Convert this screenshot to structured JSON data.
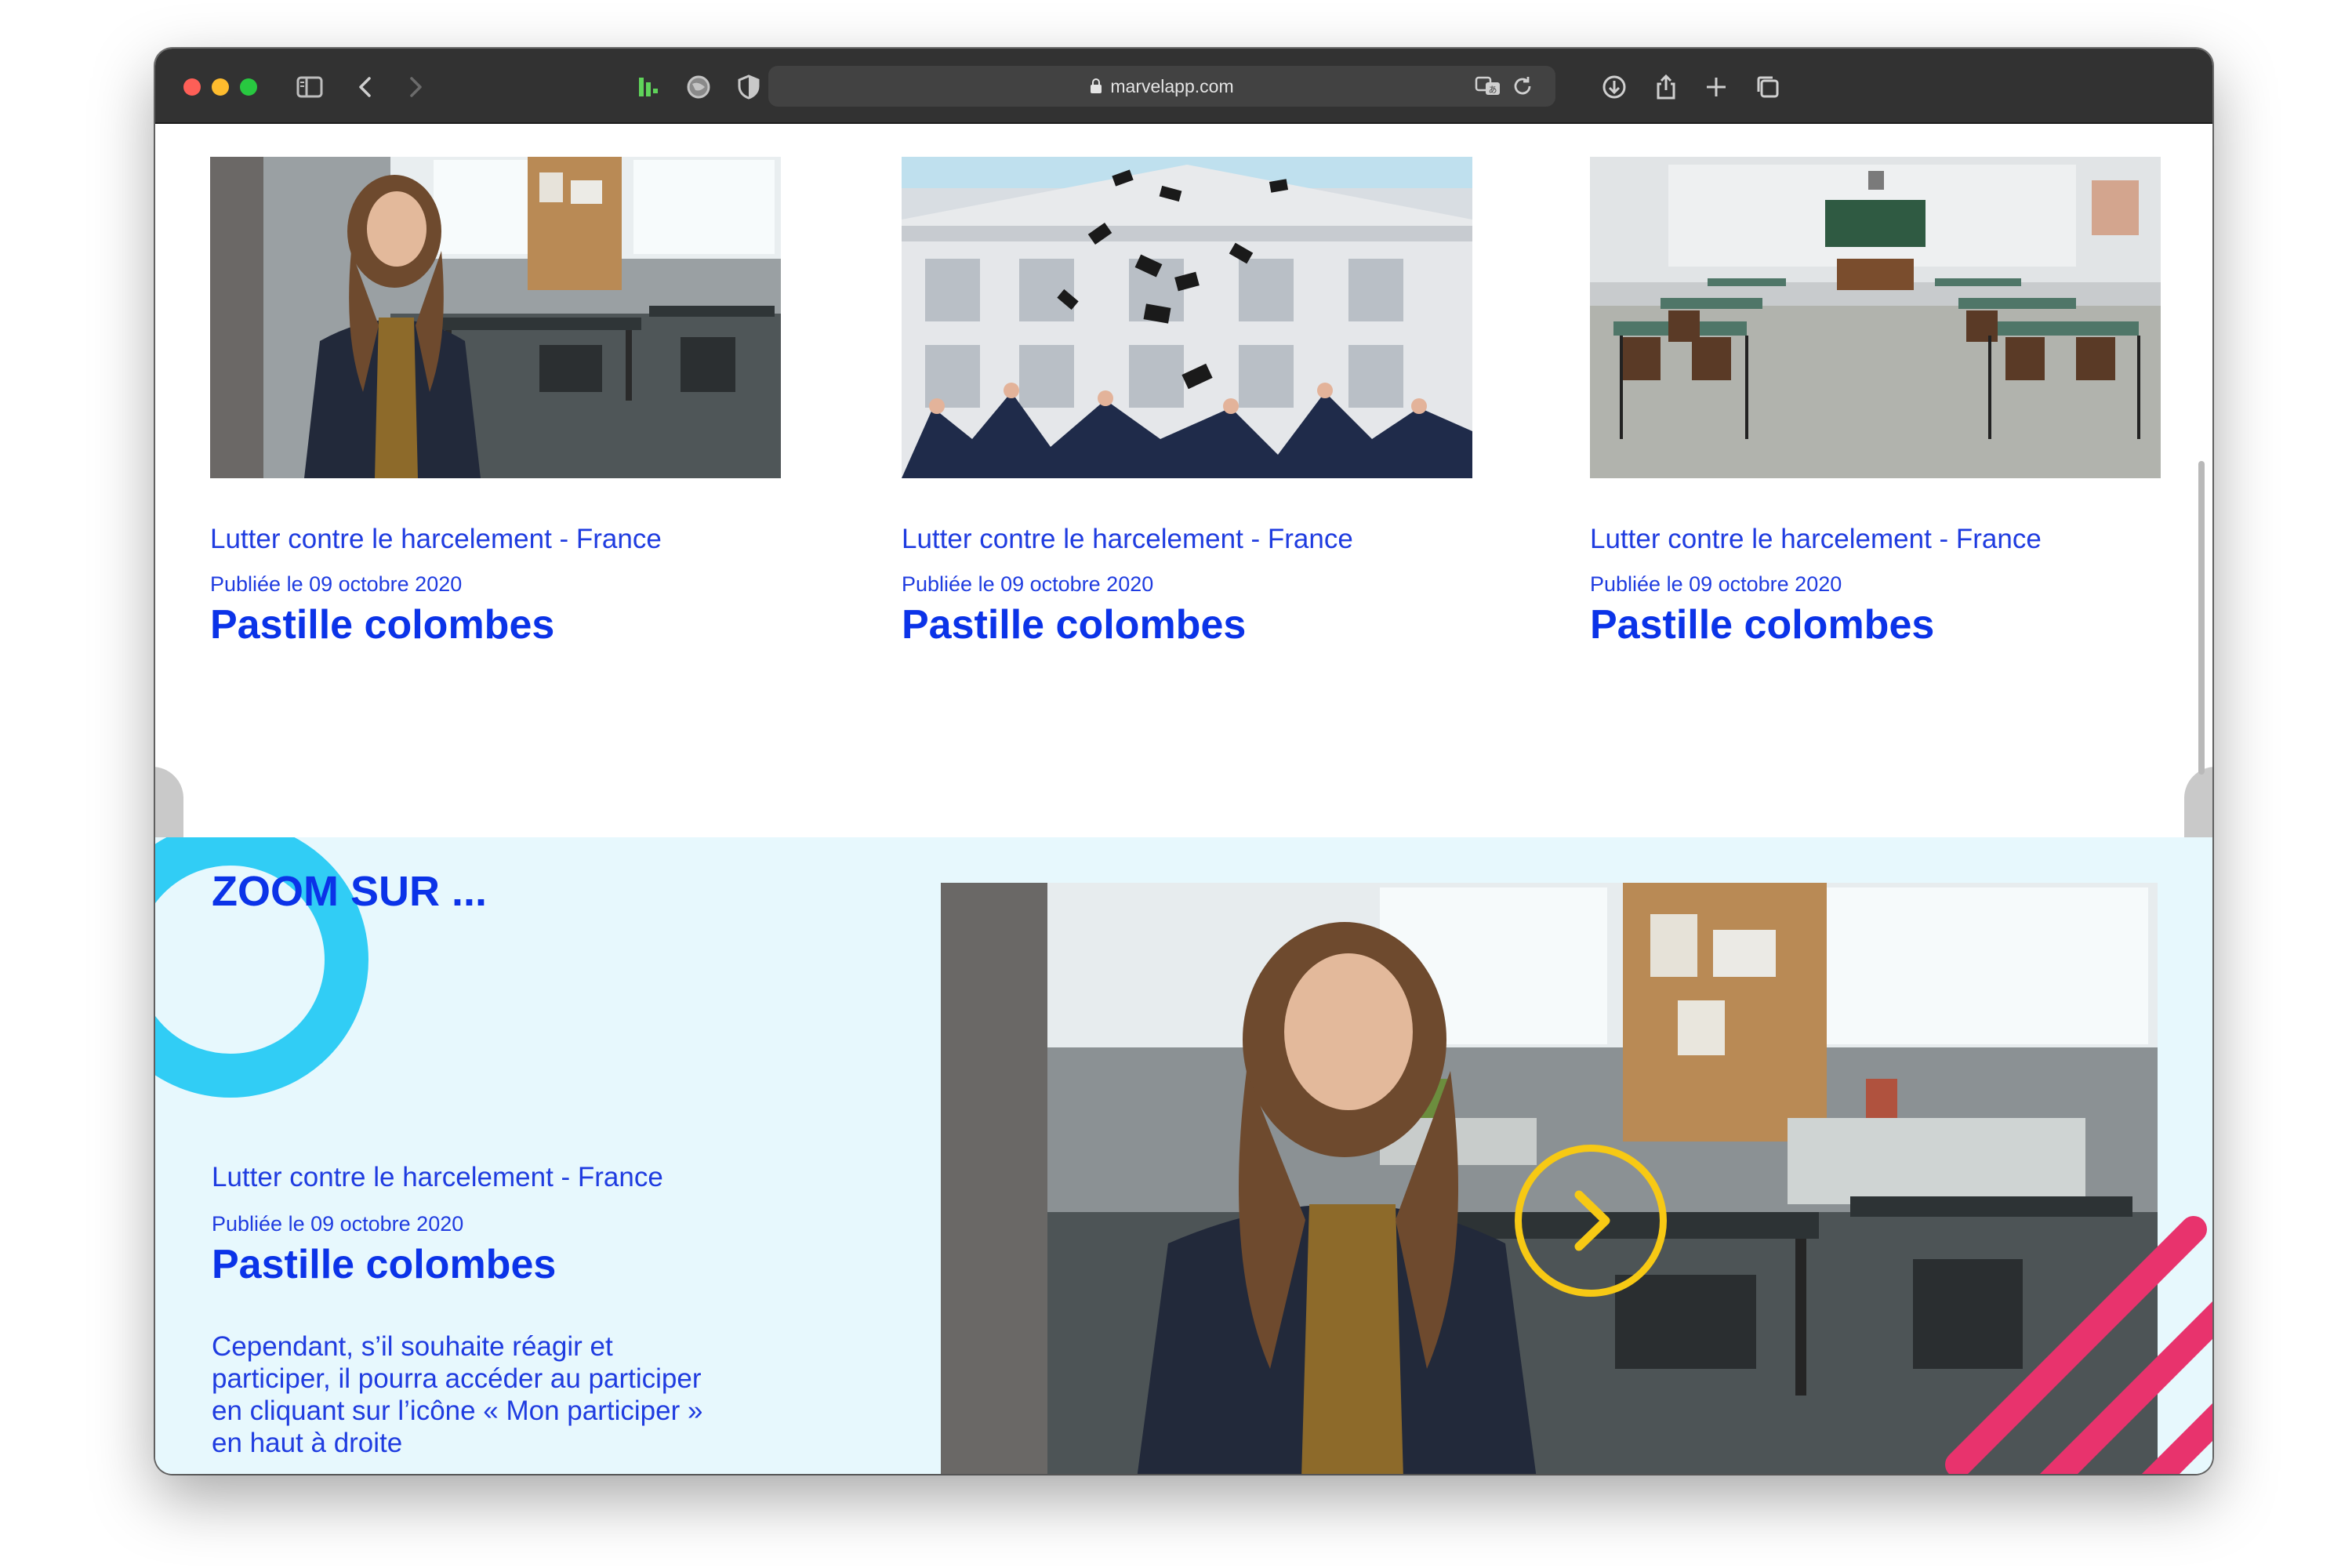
{
  "browser": {
    "url": "marvelapp.com"
  },
  "cards": [
    {
      "category": "Lutter contre le harcelement - France",
      "date": "Publiée le 09 octobre 2020",
      "title": "Pastille colombes"
    },
    {
      "category": "Lutter contre le harcelement - France",
      "date": "Publiée le 09 octobre 2020",
      "title": "Pastille colombes"
    },
    {
      "category": "Lutter contre le harcelement - France",
      "date": "Publiée le 09 octobre 2020",
      "title": "Pastille colombes"
    }
  ],
  "zoom": {
    "heading": "ZOOM SUR ...",
    "category": "Lutter contre le harcelement - France",
    "date": "Publiée le 09 octobre 2020",
    "title": "Pastille colombes",
    "body": "Cependant, s’il souhaite réagir et participer, il pourra accéder au participer en cliquant sur l’icône « Mon participer » en haut à droite"
  },
  "colors": {
    "brand_blue": "#0b33e8",
    "section_bg": "#e7f8fd",
    "ring": "#31cdf5",
    "play_ring": "#f7c914",
    "stripes": "#e8336d"
  }
}
